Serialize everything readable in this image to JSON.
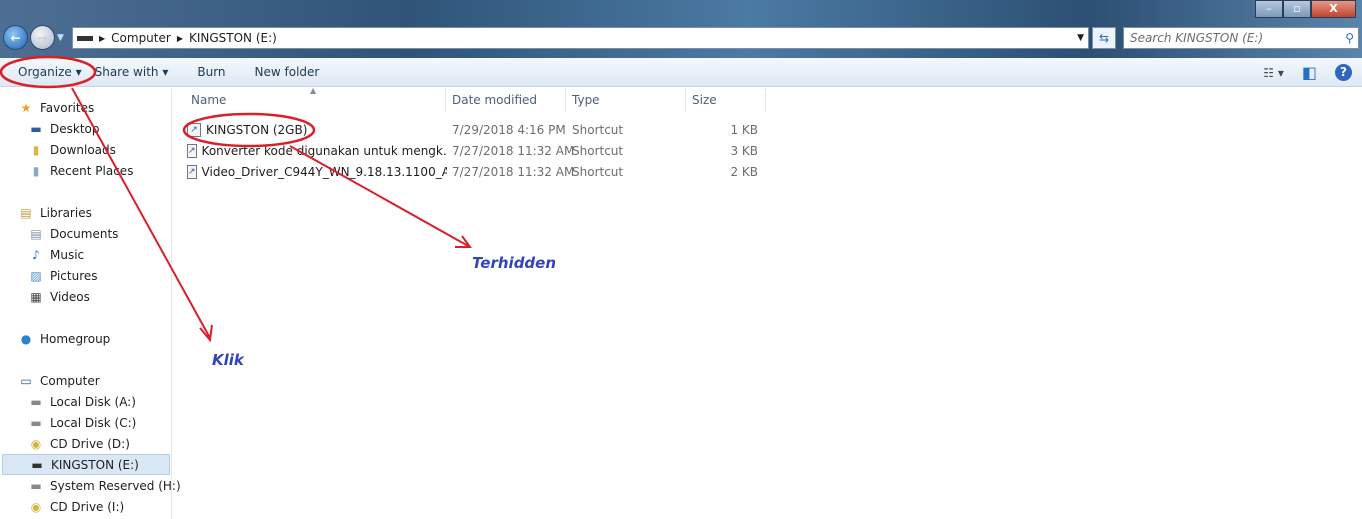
{
  "window": {
    "minimize": "–",
    "maximize": "▫",
    "close": "X"
  },
  "address": {
    "segments": [
      "Computer",
      "KINGSTON (E:)"
    ],
    "search_placeholder": "Search KINGSTON (E:)"
  },
  "toolbar": {
    "organize": "Organize ▾",
    "share_with": "Share with ▾",
    "burn": "Burn",
    "new_folder": "New folder",
    "views": "☷ ▾",
    "preview": "◧",
    "help": "?"
  },
  "sidebar": {
    "items": [
      {
        "label": "Favorites",
        "icon": "star-icon",
        "glyph": "★",
        "color": "#e8a317"
      },
      {
        "label": "Desktop",
        "icon": "desktop-icon",
        "glyph": "▬",
        "color": "#2a5d9a"
      },
      {
        "label": "Downloads",
        "icon": "downloads-folder-icon",
        "glyph": "▮",
        "color": "#d9b44a"
      },
      {
        "label": "Recent Places",
        "icon": "recent-places-icon",
        "glyph": "▮",
        "color": "#8aa9c7"
      },
      {
        "label": "Libraries",
        "icon": "libraries-icon",
        "glyph": "▤",
        "color": "#c29a3a"
      },
      {
        "label": "Documents",
        "icon": "documents-icon",
        "glyph": "▤",
        "color": "#7c8da3"
      },
      {
        "label": "Music",
        "icon": "music-icon",
        "glyph": "♪",
        "color": "#2a6fbf"
      },
      {
        "label": "Pictures",
        "icon": "pictures-icon",
        "glyph": "▨",
        "color": "#4f8cc4"
      },
      {
        "label": "Videos",
        "icon": "videos-icon",
        "glyph": "▦",
        "color": "#444"
      },
      {
        "label": "Homegroup",
        "icon": "homegroup-icon",
        "glyph": "●",
        "color": "#2d7fd0"
      },
      {
        "label": "Computer",
        "icon": "computer-icon",
        "glyph": "▭",
        "color": "#2a5d9a"
      },
      {
        "label": "Local Disk (A:)",
        "icon": "drive-icon",
        "glyph": "▬",
        "color": "#888"
      },
      {
        "label": "Local Disk (C:)",
        "icon": "drive-icon",
        "glyph": "▬",
        "color": "#888"
      },
      {
        "label": "CD Drive (D:)",
        "icon": "cd-drive-icon",
        "glyph": "◉",
        "color": "#d4b43a"
      },
      {
        "label": "KINGSTON (E:)",
        "icon": "usb-drive-icon",
        "glyph": "▬",
        "color": "#333"
      },
      {
        "label": "System Reserved (H:)",
        "icon": "drive-icon",
        "glyph": "▬",
        "color": "#888"
      },
      {
        "label": "CD Drive (I:)",
        "icon": "cd-drive-icon",
        "glyph": "◉",
        "color": "#d4b43a"
      }
    ],
    "selected": "KINGSTON (E:)"
  },
  "columns": [
    "Name",
    "Date modified",
    "Type",
    "Size"
  ],
  "files": [
    {
      "name": "KINGSTON (2GB)",
      "date": "7/29/2018 4:16 PM",
      "type": "Shortcut",
      "size": "1 KB"
    },
    {
      "name": "Konverter kode digunakan untuk mengk...",
      "date": "7/27/2018 11:32 AM",
      "type": "Shortcut",
      "size": "3 KB"
    },
    {
      "name": "Video_Driver_C944Y_WN_9.18.13.1100_A0...",
      "date": "7/27/2018 11:32 AM",
      "type": "Shortcut",
      "size": "2 KB"
    }
  ],
  "annotations": {
    "terhidden": "Terhidden",
    "klik": "Klik",
    "color": "#d8202a"
  }
}
